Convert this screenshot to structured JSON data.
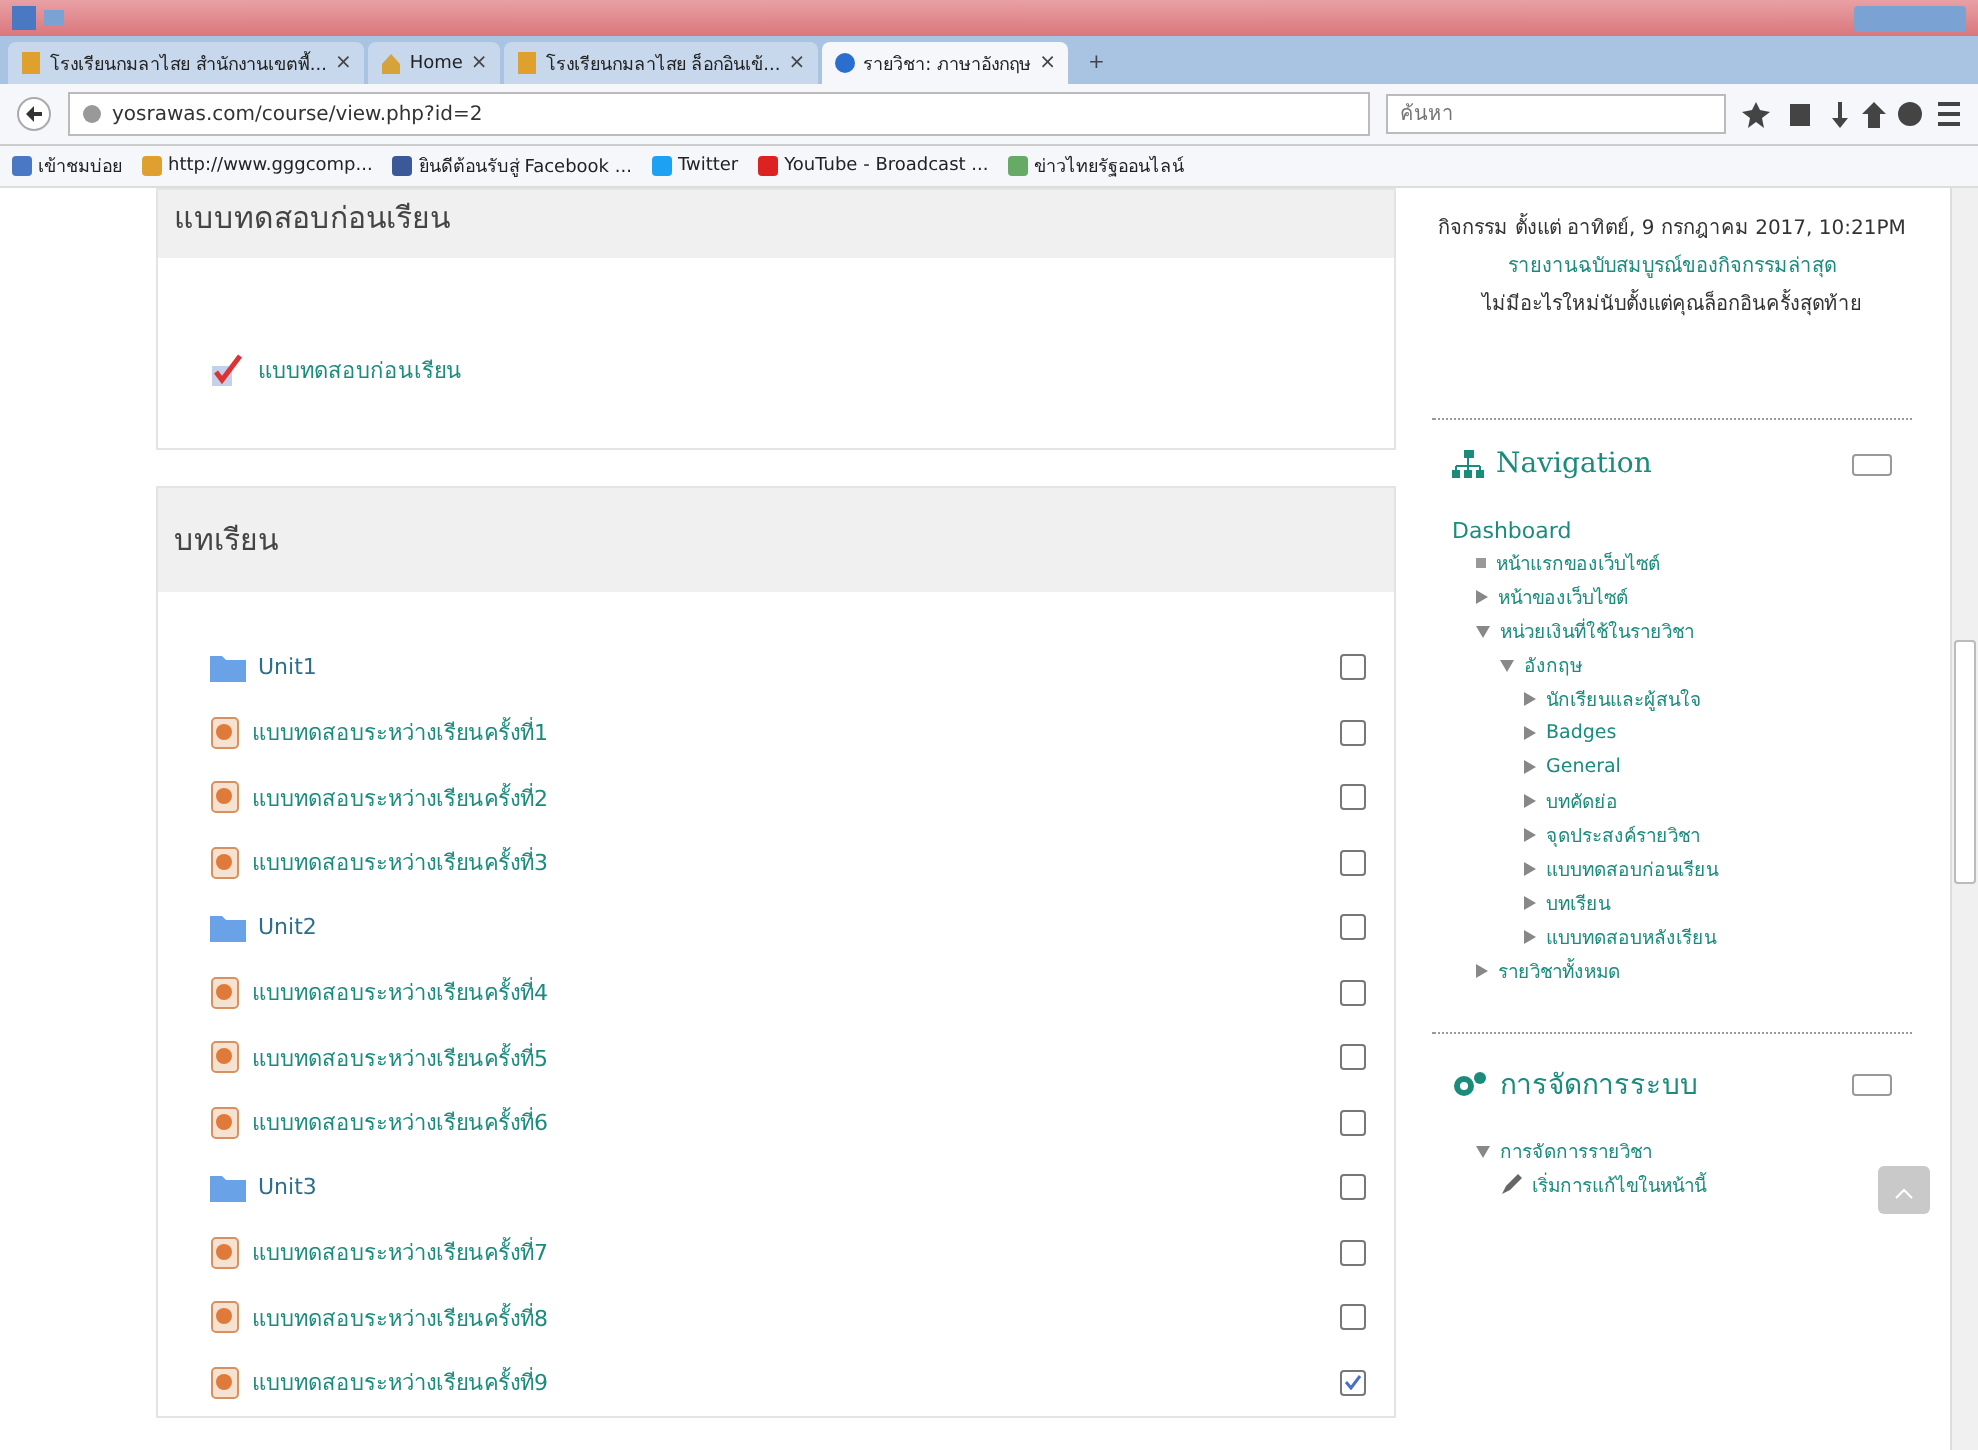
{
  "tabs": [
    {
      "label": "โรงเรียนกมลาไสย สำนักงานเขตพื้...",
      "selected": false
    },
    {
      "label": "Home",
      "selected": false
    },
    {
      "label": "โรงเรียนกมลาไสย ล็อกอินเข้...",
      "selected": false
    },
    {
      "label": "รายวิชา: ภาษาอังกฤษ",
      "selected": true
    }
  ],
  "tab_close": "×",
  "new_tab": "+",
  "address_bar": {
    "url": "yosrawas.com/course/view.php?id=2"
  },
  "search": {
    "placeholder": "ค้นหา"
  },
  "bookmarks": [
    "เข้าชมบ่อย",
    "http://www.gggcomp...",
    "ยินดีต้อนรับสู่ Facebook ...",
    "Twitter",
    "YouTube - Broadcast ...",
    "ข่าวไทยรัฐออนไลน์"
  ],
  "sections": [
    {
      "title": "แบบทดสอบก่อนเรียน",
      "items": [
        {
          "kind": "quiz",
          "title": "แบบทดสอบก่อนเรียน"
        }
      ]
    },
    {
      "title": "บทเรียน",
      "items": [
        {
          "kind": "folder",
          "title": "Unit1",
          "checked": false
        },
        {
          "kind": "file",
          "title": "แบบทดสอบระหว่างเรียนครั้งที่1",
          "checked": false
        },
        {
          "kind": "file",
          "title": "แบบทดสอบระหว่างเรียนครั้งที่2",
          "checked": false
        },
        {
          "kind": "file",
          "title": "แบบทดสอบระหว่างเรียนครั้งที่3",
          "checked": false
        },
        {
          "kind": "folder",
          "title": "Unit2",
          "checked": false
        },
        {
          "kind": "file",
          "title": "แบบทดสอบระหว่างเรียนครั้งที่4",
          "checked": false
        },
        {
          "kind": "file",
          "title": "แบบทดสอบระหว่างเรียนครั้งที่5",
          "checked": false
        },
        {
          "kind": "file",
          "title": "แบบทดสอบระหว่างเรียนครั้งที่6",
          "checked": false
        },
        {
          "kind": "folder",
          "title": "Unit3",
          "checked": false
        },
        {
          "kind": "file",
          "title": "แบบทดสอบระหว่างเรียนครั้งที่7",
          "checked": false
        },
        {
          "kind": "file",
          "title": "แบบทดสอบระหว่างเรียนครั้งที่8",
          "checked": false
        },
        {
          "kind": "file",
          "title": "แบบทดสอบระหว่างเรียนครั้งที่9",
          "checked": true
        }
      ]
    }
  ],
  "recent_activity": {
    "since": "กิจกรรม ตั้งแต่ อาทิตย์, 9 กรกฎาคม 2017, 10:21PM",
    "report_link": "รายงานฉบับสมบูรณ์ของกิจกรรมล่าสุด",
    "message": "ไม่มีอะไรใหม่นับตั้งแต่คุณล็อกอินครั้งสุดท้าย"
  },
  "navigation": {
    "title": "Navigation",
    "root": "Dashboard",
    "children": [
      {
        "kind": "leaf",
        "label": "หน้าแรกของเว็บไซต์"
      },
      {
        "kind": "branch",
        "label": "หน้าของเว็บไซต์",
        "expanded": false
      },
      {
        "kind": "branch",
        "label": "หน่วยเงินที่ใช้ในรายวิชา",
        "expanded": true,
        "children": [
          {
            "kind": "branch",
            "label": "อังกฤษ",
            "expanded": true,
            "children": [
              {
                "kind": "branch",
                "label": "นักเรียนและผู้สนใจ",
                "expanded": false
              },
              {
                "kind": "branch",
                "label": "Badges",
                "expanded": false
              },
              {
                "kind": "branch",
                "label": "General",
                "expanded": false
              },
              {
                "kind": "branch",
                "label": "บทคัดย่อ",
                "expanded": false
              },
              {
                "kind": "branch",
                "label": "จุดประสงค์รายวิชา",
                "expanded": false
              },
              {
                "kind": "branch",
                "label": "แบบทดสอบก่อนเรียน",
                "expanded": false
              },
              {
                "kind": "branch",
                "label": "บทเรียน",
                "expanded": false
              },
              {
                "kind": "branch",
                "label": "แบบทดสอบหลังเรียน",
                "expanded": false
              }
            ]
          }
        ]
      },
      {
        "kind": "branch",
        "label": "รายวิชาทั้งหมด",
        "expanded": false
      }
    ]
  },
  "administration": {
    "title": "การจัดการระบบ",
    "children": [
      {
        "kind": "branch",
        "label": "การจัดการรายวิชา",
        "expanded": true,
        "children": [
          {
            "kind": "edit",
            "label": "เริ่มการแก้ไขในหน้านี้"
          }
        ]
      }
    ]
  }
}
